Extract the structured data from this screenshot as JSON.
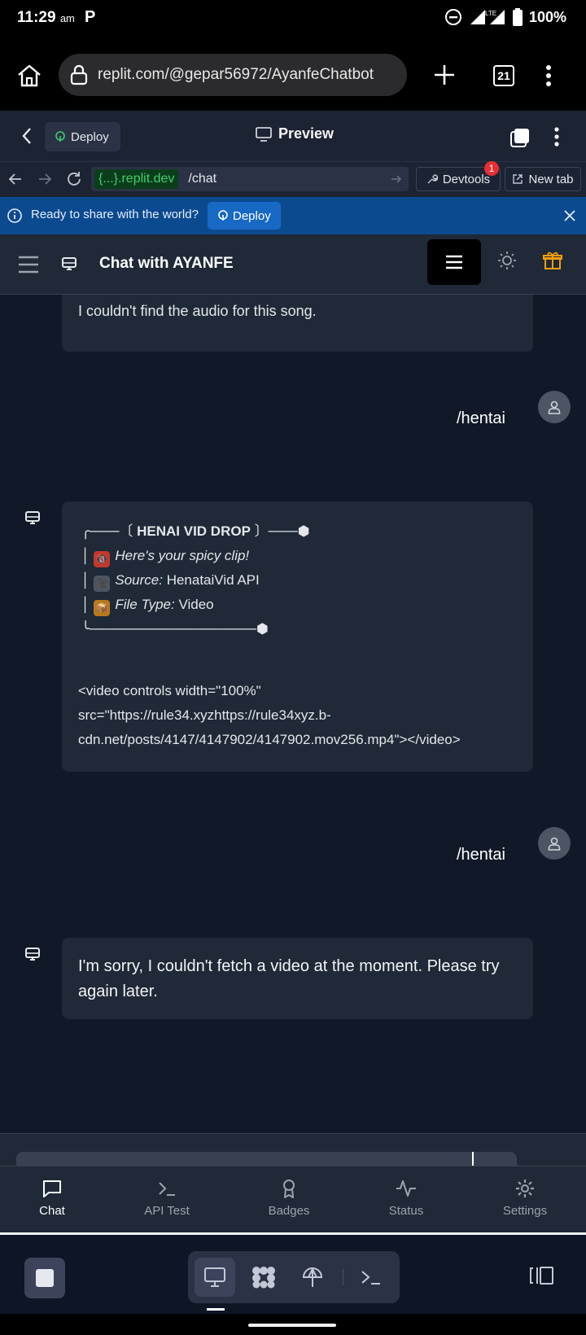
{
  "status_bar": {
    "time": "11:29",
    "ampm": "am",
    "notif_letter": "P",
    "battery": "100%"
  },
  "browser": {
    "url": "replit.com/@gepar56972/AyanfeChatbot",
    "tab_count": "21"
  },
  "replit": {
    "deploy_label": "Deploy",
    "preview_label": "Preview",
    "address_host": "{...}.replit.dev",
    "address_path": "/chat",
    "devtools_label": "Devtools",
    "devtools_badge": "1",
    "new_tab_label": "New tab",
    "banner_text": "Ready to share with the world?",
    "banner_deploy_label": "Deploy"
  },
  "chat_app": {
    "title": "Chat with AYANFE",
    "messages": {
      "m1": {
        "text": "I couldn't find the audio for this song."
      },
      "u1": {
        "text": "/hentai"
      },
      "m2": {
        "line1_open": "╭───〔",
        "line1_title": "HENAI VID DROP",
        "line1_close": "〕───⬢",
        "line2_emoji": "🔞",
        "line2_text": "Here's your spicy clip!",
        "line3_emoji": "🎥",
        "line3_label": "Source:",
        "line3_value": "HenataiVid API",
        "line4_emoji": "📦",
        "line4_label": "File Type:",
        "line4_value": "Video",
        "line5": "╰─────────────────⬢",
        "video_line1": "<video controls width=\"100%\"",
        "video_line2": "src=\"https://rule34.xyzhttps://rule34xyz.b-",
        "video_line3": "cdn.net/posts/4147/4147902/4147902.mov256.mp4\"></video>"
      },
      "u2": {
        "text": "/hentai"
      },
      "m3": {
        "line1": "I'm sorry, I couldn't fetch a video at the moment. Please try",
        "line2": "again later."
      }
    },
    "tabs": {
      "chat": "Chat",
      "api_test": "API Test",
      "badges": "Badges",
      "status": "Status",
      "settings": "Settings"
    }
  }
}
